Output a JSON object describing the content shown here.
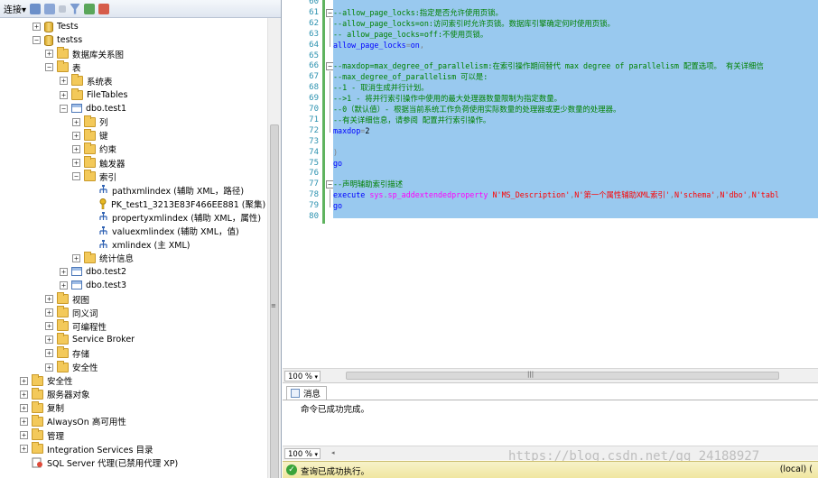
{
  "object_explorer": {
    "toolbar": {
      "connect_label": "连接▾"
    },
    "tree": [
      {
        "label": "Tests",
        "level": 2,
        "expander": "+",
        "icon": "database-icon"
      },
      {
        "label": "testss",
        "level": 2,
        "expander": "−",
        "icon": "database-icon"
      },
      {
        "label": "数据库关系图",
        "level": 3,
        "expander": "+",
        "icon": "folder-icon"
      },
      {
        "label": "表",
        "level": 3,
        "expander": "−",
        "icon": "folder-icon"
      },
      {
        "label": "系统表",
        "level": 4,
        "expander": "+",
        "icon": "folder-icon"
      },
      {
        "label": "FileTables",
        "level": 4,
        "expander": "+",
        "icon": "folder-icon"
      },
      {
        "label": "dbo.test1",
        "level": 4,
        "expander": "−",
        "icon": "table-icon"
      },
      {
        "label": "列",
        "level": 5,
        "expander": "+",
        "icon": "folder-icon"
      },
      {
        "label": "键",
        "level": 5,
        "expander": "+",
        "icon": "folder-icon"
      },
      {
        "label": "约束",
        "level": 5,
        "expander": "+",
        "icon": "folder-icon"
      },
      {
        "label": "触发器",
        "level": 5,
        "expander": "+",
        "icon": "folder-icon"
      },
      {
        "label": "索引",
        "level": 5,
        "expander": "−",
        "icon": "folder-icon"
      },
      {
        "label": "pathxmlindex (辅助 XML，路径)",
        "level": 6,
        "expander": "",
        "icon": "xml-index-icon"
      },
      {
        "label": "PK_test1_3213E83F466EE881 (聚集)",
        "level": 6,
        "expander": "",
        "icon": "primary-key-icon"
      },
      {
        "label": "propertyxmlindex (辅助 XML，属性)",
        "level": 6,
        "expander": "",
        "icon": "xml-index-icon"
      },
      {
        "label": "valuexmlindex (辅助 XML，值)",
        "level": 6,
        "expander": "",
        "icon": "xml-index-icon"
      },
      {
        "label": "xmlindex (主 XML)",
        "level": 6,
        "expander": "",
        "icon": "xml-index-icon"
      },
      {
        "label": "统计信息",
        "level": 5,
        "expander": "+",
        "icon": "folder-icon"
      },
      {
        "label": "dbo.test2",
        "level": 4,
        "expander": "+",
        "icon": "table-icon"
      },
      {
        "label": "dbo.test3",
        "level": 4,
        "expander": "+",
        "icon": "table-icon"
      },
      {
        "label": "视图",
        "level": 3,
        "expander": "+",
        "icon": "folder-icon"
      },
      {
        "label": "同义词",
        "level": 3,
        "expander": "+",
        "icon": "folder-icon"
      },
      {
        "label": "可编程性",
        "level": 3,
        "expander": "+",
        "icon": "folder-icon"
      },
      {
        "label": "Service Broker",
        "level": 3,
        "expander": "+",
        "icon": "folder-icon"
      },
      {
        "label": "存储",
        "level": 3,
        "expander": "+",
        "icon": "folder-icon"
      },
      {
        "label": "安全性",
        "level": 3,
        "expander": "+",
        "icon": "folder-icon"
      },
      {
        "label": "安全性",
        "level": 1,
        "expander": "+",
        "icon": "folder-icon"
      },
      {
        "label": "服务器对象",
        "level": 1,
        "expander": "+",
        "icon": "folder-icon"
      },
      {
        "label": "复制",
        "level": 1,
        "expander": "+",
        "icon": "folder-icon"
      },
      {
        "label": "AlwaysOn 高可用性",
        "level": 1,
        "expander": "+",
        "icon": "folder-icon"
      },
      {
        "label": "管理",
        "level": 1,
        "expander": "+",
        "icon": "folder-icon"
      },
      {
        "label": "Integration Services 目录",
        "level": 1,
        "expander": "+",
        "icon": "folder-icon"
      },
      {
        "label": "SQL Server 代理(已禁用代理 XP)",
        "level": 1,
        "expander": "",
        "icon": "sql-agent-icon"
      }
    ]
  },
  "editor": {
    "lines": [
      {
        "no": "60",
        "parts": []
      },
      {
        "no": "61",
        "fold": "−",
        "parts": [
          {
            "c": "cm",
            "t": "--allow_page_locks:指定是否允许使用页锁。"
          }
        ]
      },
      {
        "no": "62",
        "parts": [
          {
            "c": "cm",
            "t": "--allow_page_locks=on:访问索引时允许页锁。数据库引擎确定何时使用页锁。"
          }
        ]
      },
      {
        "no": "63",
        "parts": [
          {
            "c": "cm",
            "t": "-- allow_page_locks=off:不使用页锁。"
          }
        ]
      },
      {
        "no": "64",
        "parts": [
          {
            "c": "kw",
            "t": "allow_page_locks"
          },
          {
            "c": "gr",
            "t": "="
          },
          {
            "c": "kw",
            "t": "on"
          },
          {
            "c": "gr",
            "t": ","
          }
        ]
      },
      {
        "no": "65",
        "parts": []
      },
      {
        "no": "66",
        "fold": "−",
        "parts": [
          {
            "c": "cm",
            "t": "--maxdop=max_degree_of_parallelism:在索引操作期间替代 max degree of parallelism 配置选项。 有关详细信"
          }
        ]
      },
      {
        "no": "67",
        "parts": [
          {
            "c": "cm",
            "t": "--max_degree_of_parallelism 可以是:"
          }
        ]
      },
      {
        "no": "68",
        "parts": [
          {
            "c": "cm",
            "t": "--1 - 取消生成并行计划。"
          }
        ]
      },
      {
        "no": "69",
        "parts": [
          {
            "c": "cm",
            "t": "-->1 - 将并行索引操作中使用的最大处理器数量限制为指定数量。"
          }
        ]
      },
      {
        "no": "70",
        "parts": [
          {
            "c": "cm",
            "t": "--0（默认值）- 根据当前系统工作负荷使用实际数量的处理器或更少数量的处理器。"
          }
        ]
      },
      {
        "no": "71",
        "parts": [
          {
            "c": "cm",
            "t": "--有关详细信息，请参阅 配置并行索引操作。"
          }
        ]
      },
      {
        "no": "72",
        "parts": [
          {
            "c": "kw",
            "t": "maxdop"
          },
          {
            "c": "gr",
            "t": "="
          },
          {
            "c": "",
            "t": "2"
          }
        ]
      },
      {
        "no": "73",
        "parts": []
      },
      {
        "no": "74",
        "parts": [
          {
            "c": "gr",
            "t": ")"
          }
        ]
      },
      {
        "no": "75",
        "parts": [
          {
            "c": "kw",
            "t": "go"
          }
        ]
      },
      {
        "no": "76",
        "parts": []
      },
      {
        "no": "77",
        "fold": "−",
        "parts": [
          {
            "c": "cm",
            "t": "--声明辅助索引描述"
          }
        ]
      },
      {
        "no": "78",
        "parts": [
          {
            "c": "kw",
            "t": "execute "
          },
          {
            "c": "fn",
            "t": "sys"
          },
          {
            "c": "gr",
            "t": "."
          },
          {
            "c": "fn",
            "t": "sp_addextendedproperty "
          },
          {
            "c": "st",
            "t": "N'MS_Description'"
          },
          {
            "c": "gr",
            "t": ","
          },
          {
            "c": "st",
            "t": "N'第一个属性辅助XML索引'"
          },
          {
            "c": "gr",
            "t": ","
          },
          {
            "c": "st",
            "t": "N'schema'"
          },
          {
            "c": "gr",
            "t": ","
          },
          {
            "c": "st",
            "t": "N'dbo'"
          },
          {
            "c": "gr",
            "t": ","
          },
          {
            "c": "st",
            "t": "N'tabl"
          }
        ]
      },
      {
        "no": "79",
        "parts": [
          {
            "c": "kw",
            "t": "go"
          }
        ]
      },
      {
        "no": "80",
        "parts": []
      }
    ],
    "zoom": "100 %"
  },
  "results": {
    "tab_label": "消息",
    "message": "命令已成功完成。",
    "zoom": "100 %"
  },
  "status": {
    "text": "查询已成功执行。",
    "server": "(local) ("
  },
  "watermark": "https://blog.csdn.net/qq_24188927",
  "colors": {
    "selection": "#99c9ef",
    "comment": "#008000",
    "keyword": "#0000ff",
    "string": "#ff0000",
    "system_function": "#ff00ff",
    "line_number": "#2b91af",
    "status_bar": "#f0e6a0"
  }
}
